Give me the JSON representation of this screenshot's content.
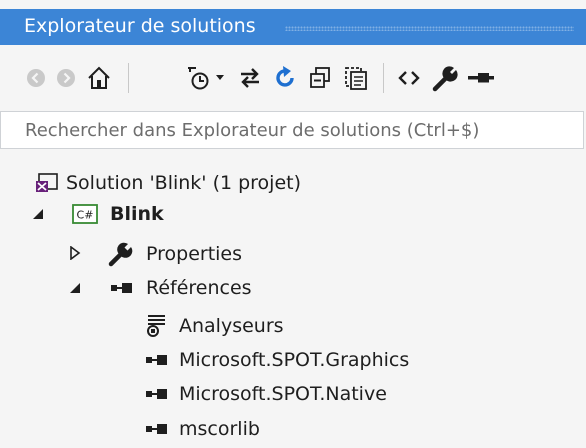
{
  "panel": {
    "title": "Explorateur de solutions"
  },
  "toolbar": {
    "buttons": [
      {
        "icon": "back-icon"
      },
      {
        "icon": "forward-icon"
      },
      {
        "icon": "home-icon"
      },
      {
        "icon": "history-icon"
      },
      {
        "icon": "dropdown-icon"
      },
      {
        "icon": "sync-icon"
      },
      {
        "icon": "refresh-icon"
      },
      {
        "icon": "collapse-all-icon"
      },
      {
        "icon": "show-all-files-icon"
      },
      {
        "icon": "view-code-icon"
      },
      {
        "icon": "properties-icon"
      },
      {
        "icon": "preview-icon"
      }
    ]
  },
  "search": {
    "placeholder": "Rechercher dans Explorateur de solutions (Ctrl+$)"
  },
  "tree": {
    "solution": {
      "label": "Solution 'Blink' (1 projet)",
      "icon": "solution-icon"
    },
    "project": {
      "label": "Blink",
      "icon": "csharp-project-icon",
      "expanded": true
    },
    "properties": {
      "label": "Properties",
      "icon": "wrench-icon",
      "expanded": false
    },
    "references": {
      "label": "Références",
      "icon": "references-icon",
      "expanded": true
    },
    "children": [
      {
        "label": "Analyseurs",
        "icon": "analyzer-icon"
      },
      {
        "label": "Microsoft.SPOT.Graphics",
        "icon": "reference-icon"
      },
      {
        "label": "Microsoft.SPOT.Native",
        "icon": "reference-icon"
      },
      {
        "label": "mscorlib",
        "icon": "reference-icon"
      }
    ]
  },
  "colors": {
    "titlebar": "#3c85d6",
    "background": "#f5f5f5",
    "accent_blue": "#1e6fd0",
    "solution_purple": "#68217a"
  }
}
